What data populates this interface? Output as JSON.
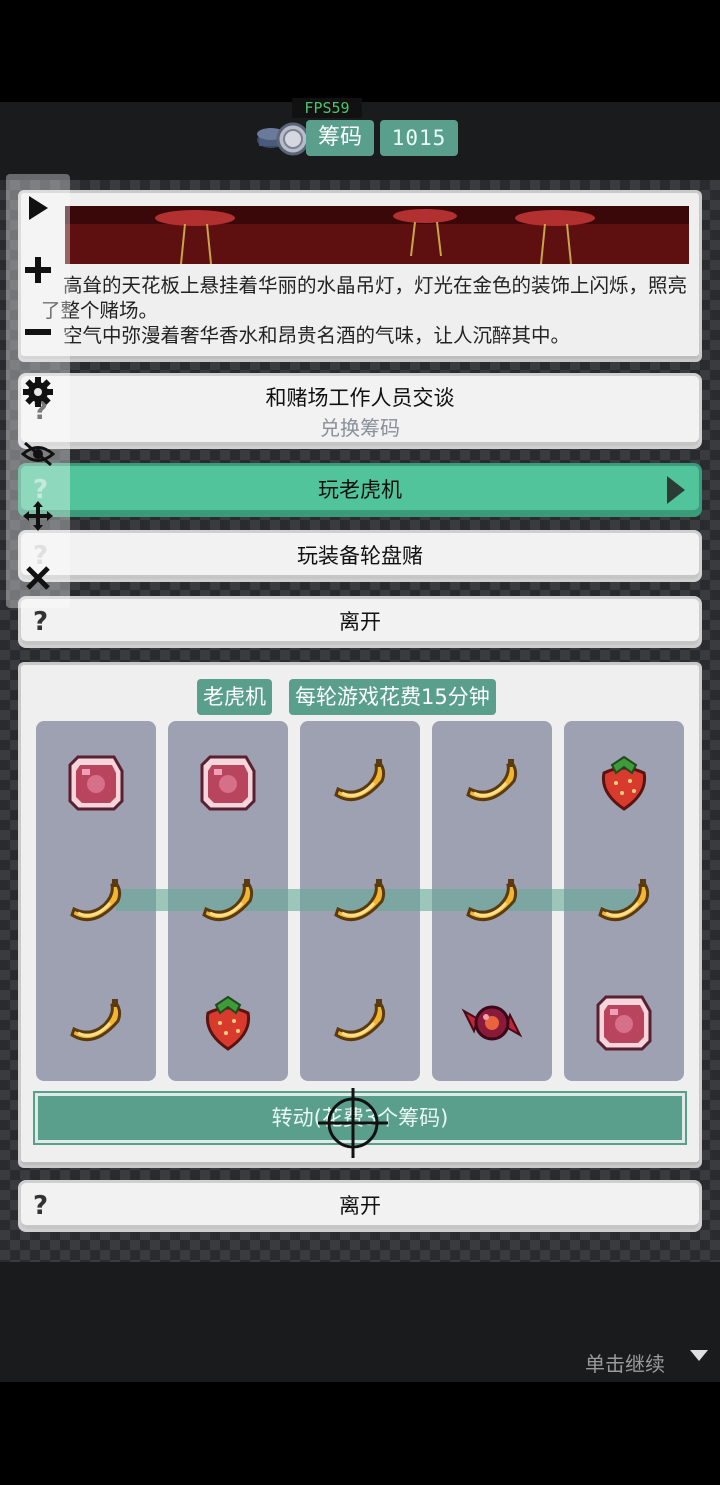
{
  "hud": {
    "fps": "FPS59",
    "currency_label": "筹码",
    "currency_value": "1015"
  },
  "story": {
    "line1": "高耸的天花板上悬挂着华丽的水晶吊灯，灯光在金色的装饰上闪烁，照亮了整个赌场。",
    "line2": "空气中弥漫着奢华香水和昂贵名酒的气味，让人沉醉其中。"
  },
  "choices": [
    {
      "label": "和赌场工作人员交谈",
      "sub": "兑换筹码"
    },
    {
      "label": "玩老虎机"
    },
    {
      "label": "玩装备轮盘赌"
    },
    {
      "label": "离开"
    }
  ],
  "slot": {
    "title": "老虎机",
    "cost_note": "每轮游戏花费15分钟",
    "spin_label": "转动(花费3个筹码)",
    "reels": [
      [
        "gem",
        "banana",
        "banana"
      ],
      [
        "gem",
        "banana",
        "strawberry"
      ],
      [
        "banana",
        "banana",
        "banana"
      ],
      [
        "banana",
        "banana",
        "candy"
      ],
      [
        "strawberry",
        "banana",
        "gem"
      ]
    ]
  },
  "bottom_choice": {
    "label": "离开"
  },
  "qmark": "?",
  "continue_label": "单击继续",
  "colors": {
    "accent_green": "#52c49c",
    "teal_tag": "#5a9f8c",
    "reel_gray": "#9ea1b1"
  }
}
